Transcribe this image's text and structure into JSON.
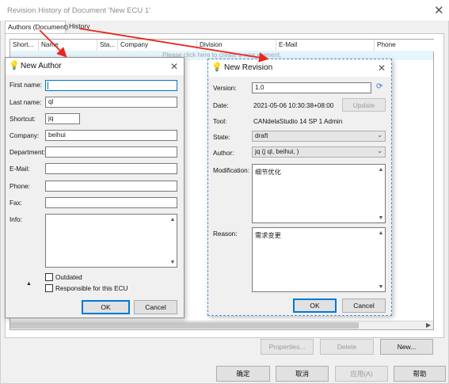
{
  "main_window": {
    "title": "Revision History of Document 'New ECU 1'",
    "tabs": [
      "Authors (Document)",
      "History"
    ],
    "columns": [
      "Short...",
      "Name",
      "Sta...",
      "Company",
      "Division",
      "E-Mail",
      "Phone"
    ],
    "new_row_hint": "Please click here to create a new element.",
    "buttons": {
      "properties": "Properties...",
      "delete": "Delete",
      "new": "New..."
    },
    "footer": {
      "ok": "确定",
      "cancel": "取消",
      "apply": "应用(A)",
      "help": "帮助"
    }
  },
  "new_author": {
    "title": "New Author",
    "labels": {
      "first_name": "First name:",
      "last_name": "Last name:",
      "shortcut": "Shortcut:",
      "company": "Company:",
      "department": "Department:",
      "email": "E-Mail:",
      "phone": "Phone:",
      "fax": "Fax:",
      "info": "Info:"
    },
    "values": {
      "first_name": "",
      "last_name": "ql",
      "shortcut": "jq",
      "company": "beihui",
      "department": "",
      "email": "",
      "phone": "",
      "fax": "",
      "info": ""
    },
    "checks": {
      "outdated": "Outdated",
      "responsible": "Responsible for this ECU"
    },
    "ok": "OK",
    "cancel": "Cancel"
  },
  "new_revision": {
    "title": "New Revision",
    "labels": {
      "version": "Version:",
      "date": "Date:",
      "tool": "Tool:",
      "state": "State:",
      "author": "Author:",
      "modification": "Modification:",
      "reason": "Reason:"
    },
    "values": {
      "version": "1.0",
      "date": "2021-05-06 10:30:38+08:00",
      "tool": "CANdelaStudio 14 SP 1  Admin",
      "state": "draft",
      "author": "jq (j ql, beihui, )",
      "modification": "细节优化",
      "reason": "需求变更"
    },
    "update": "Update",
    "ok": "OK",
    "cancel": "Cancel"
  },
  "colors": {
    "accent": "#0078d7",
    "annotation_arrow": "#e8261e"
  }
}
